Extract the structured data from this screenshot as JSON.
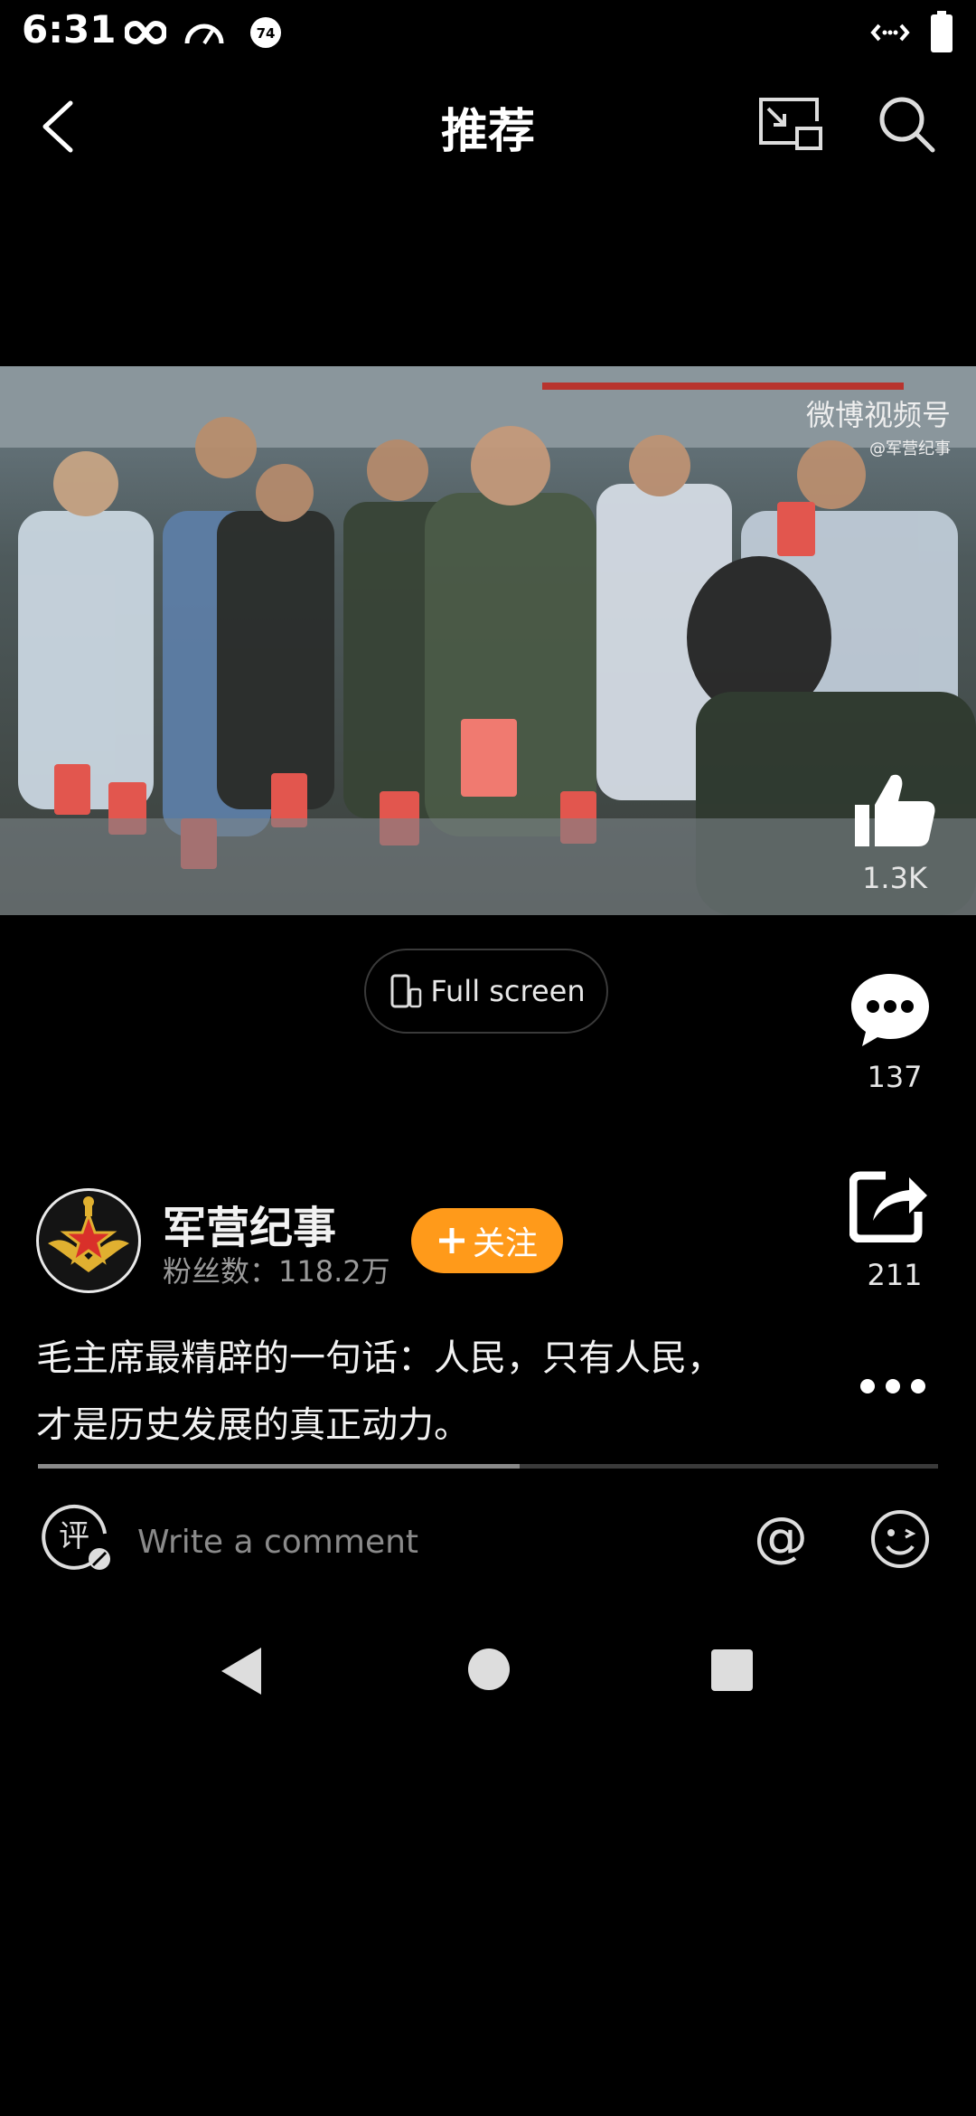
{
  "status_bar": {
    "time": "6:31"
  },
  "header": {
    "title": "推荐"
  },
  "video": {
    "watermark": "微博视频号",
    "watermark_sub": "@军营纪事"
  },
  "actions": {
    "likes": "1.3K",
    "comments": "137",
    "shares": "211"
  },
  "fullscreen": {
    "label": "Full screen"
  },
  "author": {
    "name": "军营纪事",
    "fans": "粉丝数：118.2万",
    "follow_label": "关注"
  },
  "description": {
    "line1": "毛主席最精辟的一句话：人民，只有人民，",
    "line2": "才是历史发展的真正动力。"
  },
  "playback": {
    "progress": 0.535
  },
  "comment_bar": {
    "placeholder": "Write a comment"
  },
  "colors": {
    "accent": "#ff9a1a",
    "background": "#000000"
  },
  "icons": [
    "back-arrow-icon",
    "pip-icon",
    "search-icon",
    "thumbs-up-icon",
    "comment-bubble-icon",
    "share-icon",
    "more-dots-icon",
    "review-icon",
    "at-icon",
    "emoji-icon"
  ]
}
